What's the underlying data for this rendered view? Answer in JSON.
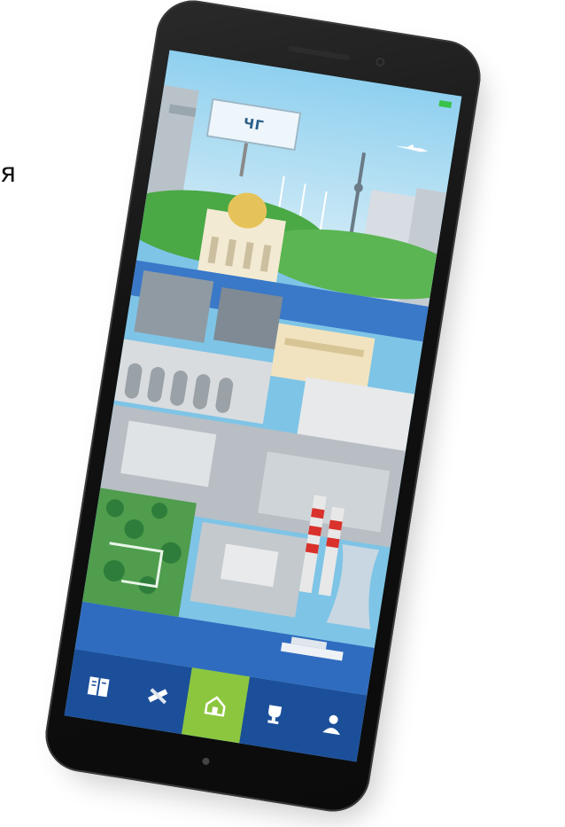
{
  "edge_text": "я",
  "app": {
    "billboard_text": "ЧГ",
    "status_indicator_color": "#38c24a",
    "accent_color": "#8cc63f",
    "nav_bar_color": "#1c4f9a"
  },
  "bottom_nav": {
    "items": [
      {
        "icon": "book-icon",
        "active": false
      },
      {
        "icon": "pencil-ruler-icon",
        "active": false
      },
      {
        "icon": "home-icon",
        "active": true
      },
      {
        "icon": "trophy-icon",
        "active": false
      },
      {
        "icon": "user-icon",
        "active": false
      }
    ]
  }
}
